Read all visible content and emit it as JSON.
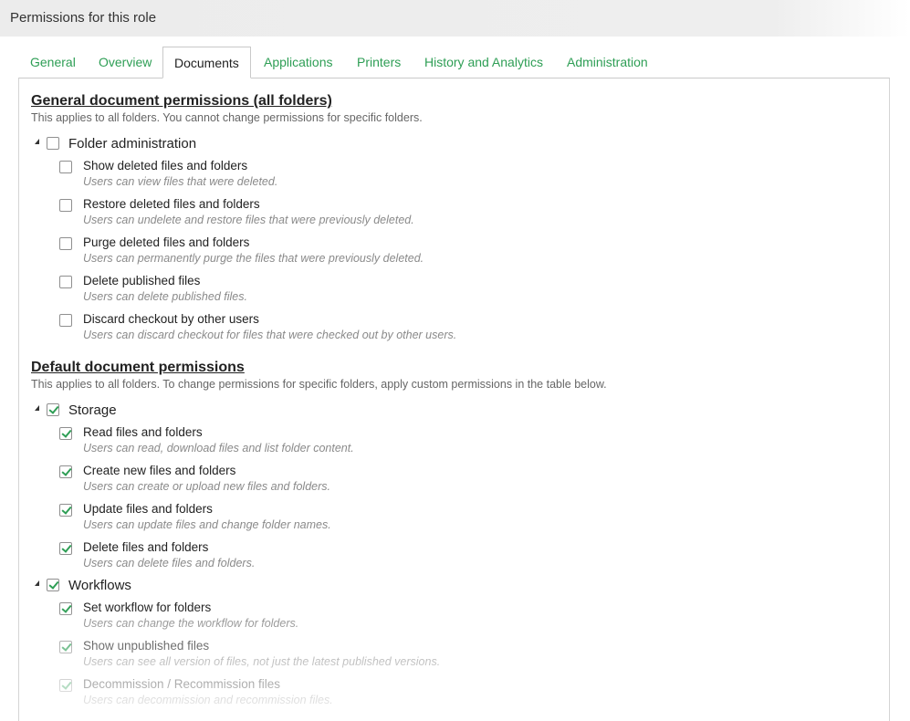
{
  "window": {
    "title": "Permissions for this role"
  },
  "tabs": [
    {
      "label": "General"
    },
    {
      "label": "Overview"
    },
    {
      "label": "Documents"
    },
    {
      "label": "Applications"
    },
    {
      "label": "Printers"
    },
    {
      "label": "History and Analytics"
    },
    {
      "label": "Administration"
    }
  ],
  "active_tab": "Documents",
  "sections": [
    {
      "title": "General document permissions (all folders)",
      "subtitle": "This applies to all folders. You cannot change permissions for specific folders.",
      "groups": [
        {
          "label": "Folder administration",
          "checked": false,
          "items": [
            {
              "label": "Show deleted files and folders",
              "desc": "Users can view files that were deleted.",
              "checked": false
            },
            {
              "label": "Restore deleted files and folders",
              "desc": "Users can undelete and restore files that were previously deleted.",
              "checked": false
            },
            {
              "label": "Purge deleted files and folders",
              "desc": "Users can permanently purge the files that were previously deleted.",
              "checked": false
            },
            {
              "label": "Delete published files",
              "desc": "Users can delete published files.",
              "checked": false
            },
            {
              "label": "Discard checkout by other users",
              "desc": "Users can discard checkout for files that were checked out by other users.",
              "checked": false
            }
          ]
        }
      ]
    },
    {
      "title": "Default document permissions",
      "subtitle": "This applies to all folders. To change permissions for specific folders, apply custom permissions in the table below.",
      "groups": [
        {
          "label": "Storage",
          "checked": true,
          "items": [
            {
              "label": "Read files and folders",
              "desc": "Users can read, download files and list folder content.",
              "checked": true
            },
            {
              "label": "Create new files and folders",
              "desc": "Users can create or upload new files and folders.",
              "checked": true
            },
            {
              "label": "Update files and folders",
              "desc": "Users can update files and change folder names.",
              "checked": true
            },
            {
              "label": "Delete files and folders",
              "desc": "Users can delete files and folders.",
              "checked": true
            }
          ]
        },
        {
          "label": "Workflows",
          "checked": true,
          "items": [
            {
              "label": "Set workflow for folders",
              "desc": "Users can change the workflow for folders.",
              "checked": true
            },
            {
              "label": "Show unpublished files",
              "desc": "Users can see all version of files, not just the latest published versions.",
              "checked": true
            },
            {
              "label": "Decommission / Recommission files",
              "desc": "Users can decommission and recommission files.",
              "checked": true
            }
          ]
        }
      ]
    }
  ],
  "colors": {
    "accent": "#2e9e55",
    "description": "#8a8a8a"
  }
}
